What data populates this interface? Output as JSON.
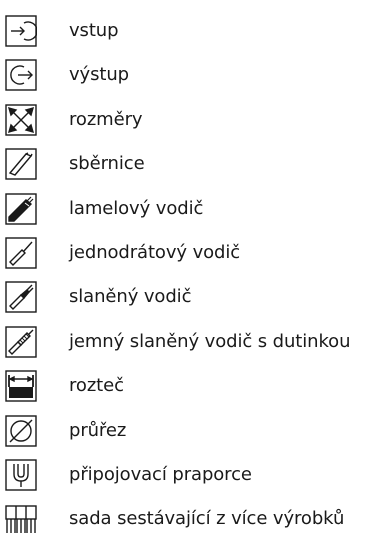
{
  "legend": {
    "items": [
      {
        "icon": "input-arrow-icon",
        "label": "vstup"
      },
      {
        "icon": "output-arrow-icon",
        "label": "výstup"
      },
      {
        "icon": "dimensions-icon",
        "label": "rozměry"
      },
      {
        "icon": "busbar-icon",
        "label": "sběrnice"
      },
      {
        "icon": "laminated-conductor-icon",
        "label": "lamelový vodič"
      },
      {
        "icon": "solid-wire-icon",
        "label": "jednodrátový vodič"
      },
      {
        "icon": "stranded-wire-icon",
        "label": "slaněný vodič"
      },
      {
        "icon": "fine-stranded-ferrule-icon",
        "label": "jemný slaněný vodič s dutinkou"
      },
      {
        "icon": "pitch-icon",
        "label": "rozteč"
      },
      {
        "icon": "cross-section-icon",
        "label": "průřez"
      },
      {
        "icon": "connection-lug-icon",
        "label": "připojovací praporce"
      },
      {
        "icon": "multi-product-set-icon",
        "label": "sada sestávající z více výrobků"
      }
    ]
  }
}
